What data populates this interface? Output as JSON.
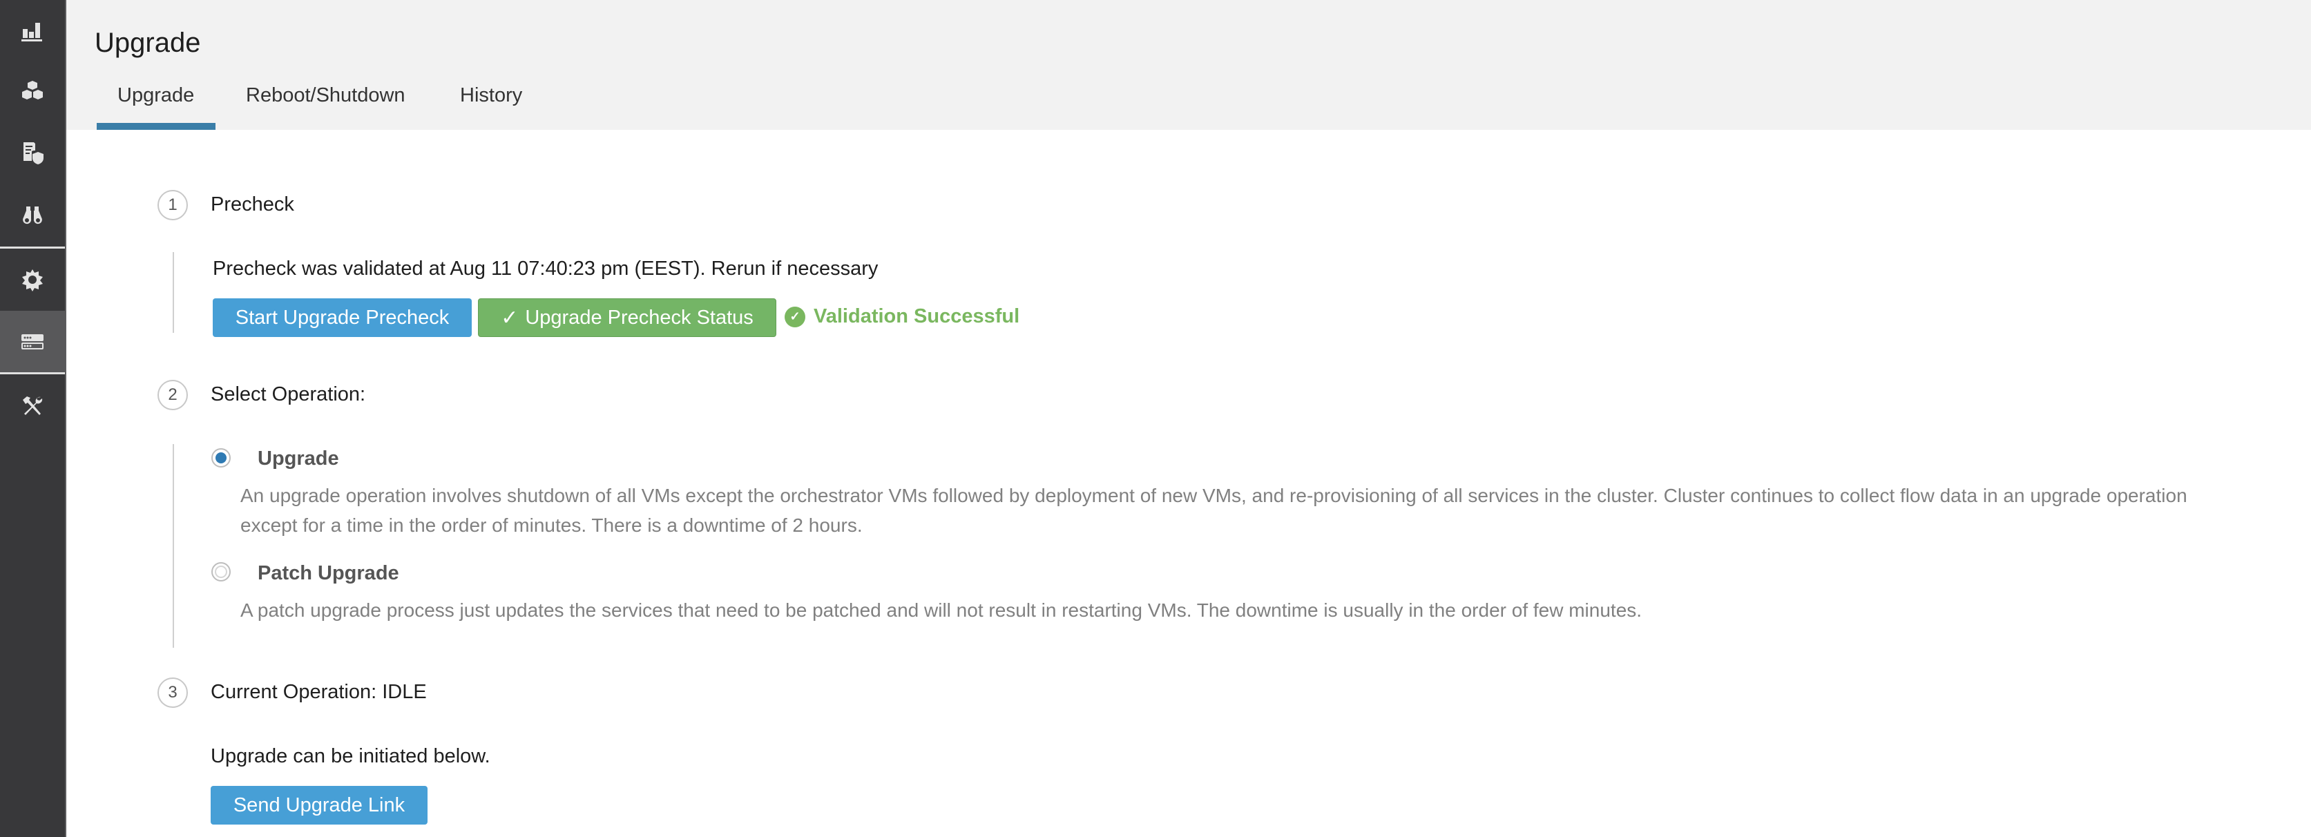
{
  "sidebar": {
    "items": [
      {
        "icon": "bar-chart-icon",
        "label": "Dashboard",
        "active": false
      },
      {
        "icon": "cubes-icon",
        "label": "Applications",
        "active": false
      },
      {
        "icon": "document-shield-icon",
        "label": "Policies",
        "active": false
      },
      {
        "icon": "binoculars-icon",
        "label": "Investigate",
        "active": false
      },
      {
        "icon": "gear-icon",
        "label": "Settings",
        "active": false
      },
      {
        "icon": "servers-icon",
        "label": "Cluster",
        "active": true
      },
      {
        "icon": "tools-icon",
        "label": "Maintenance",
        "active": false
      }
    ]
  },
  "header": {
    "title": "Upgrade",
    "tabs": [
      {
        "label": "Upgrade",
        "active": true
      },
      {
        "label": "Reboot/Shutdown",
        "active": false
      },
      {
        "label": "History",
        "active": false
      }
    ]
  },
  "steps": {
    "precheck": {
      "number": "1",
      "label": "Precheck",
      "message": "Precheck was validated at Aug 11 07:40:23 pm (EEST). Rerun if necessary",
      "start_button": "Start Upgrade Precheck",
      "status_button": "Upgrade Precheck Status",
      "status_check_glyph": "✓",
      "validation_text": "Validation Successful",
      "validation_glyph": "✓"
    },
    "select_operation": {
      "number": "2",
      "label": "Select Operation:",
      "options": [
        {
          "label": "Upgrade",
          "selected": true,
          "description_lines": [
            "An upgrade operation involves shutdown of all VMs except the orchestrator VMs followed by deployment of new VMs, and re-provisioning of all services in the cluster. Cluster continues to collect flow data in an upgrade operation",
            "except for a time in the order of minutes. There is a downtime of 2 hours."
          ]
        },
        {
          "label": "Patch Upgrade",
          "selected": false,
          "description_lines": [
            "A patch upgrade process just updates the services that need to be patched and will not result in restarting VMs. The downtime is usually in the order of few minutes."
          ]
        }
      ]
    },
    "current_operation": {
      "number": "3",
      "label": "Current Operation: IDLE",
      "message": "Upgrade can be initiated below.",
      "send_button": "Send Upgrade Link"
    }
  },
  "colors": {
    "sidebar_bg": "#38383a",
    "sidebar_active": "#58585a",
    "tab_accent": "#3a7ea8",
    "primary_button": "#479fd6",
    "success_button": "#74b566",
    "success_text": "#7ab75f",
    "radio_selected": "#2f7ab3"
  }
}
